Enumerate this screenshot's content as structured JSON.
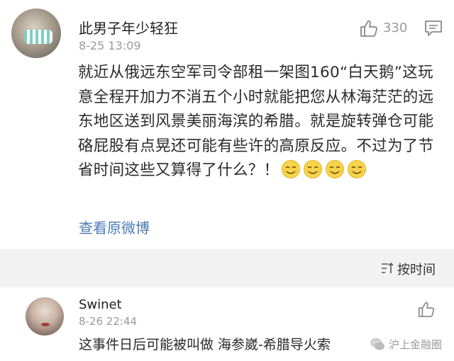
{
  "comment1": {
    "author": "此男子年少轻狂",
    "time": "8-25 13:09",
    "likes": "330",
    "text": "就近从俄远东空军司令部租一架图160“白天鹅”这玩意全程开加力不消五个小时就能把您从林海茫茫的远东地区送到风景美丽海滨的希腊。就是旋转弹仓可能硌屁股有点晃还可能有些许的高原反应。不过为了节省时间这些又算得了什么？！",
    "emoji_count": 4,
    "view_original_label": "查看原微博"
  },
  "sort": {
    "label": "按时间"
  },
  "comment2": {
    "author": "Swinet",
    "time": "8-26 22:44",
    "text": "这事件日后可能被叫做 海参崴-希腊导火索"
  },
  "watermark": {
    "text": "沪上金融圈"
  },
  "colors": {
    "link": "#4a7ab5",
    "muted": "#9a9a9a",
    "background": "#f2f2f2"
  }
}
